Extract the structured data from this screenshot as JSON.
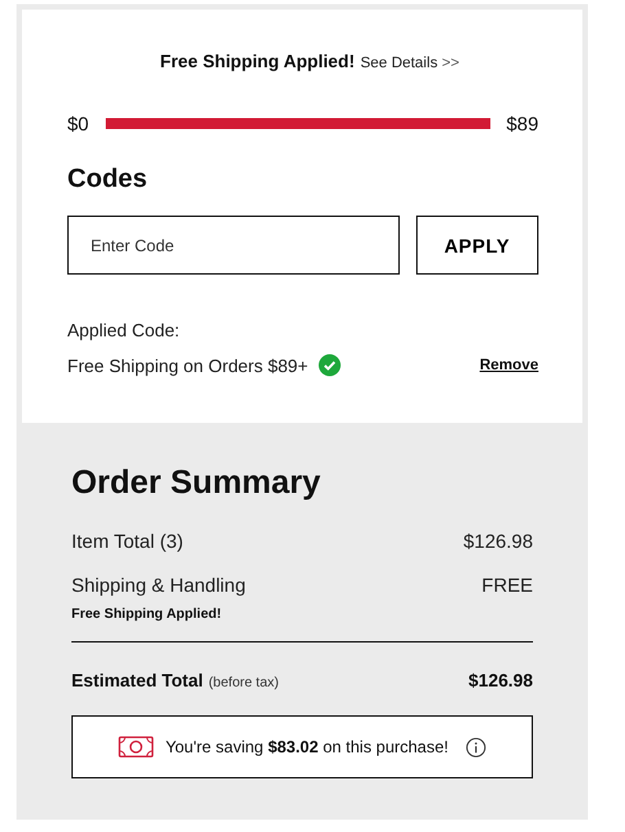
{
  "shipping_banner": {
    "title": "Free Shipping Applied!",
    "link": "See Details",
    "link_arrows": ">>"
  },
  "progress": {
    "min_label": "$0",
    "max_label": "$89",
    "level": 1
  },
  "codes": {
    "title": "Codes",
    "placeholder": "Enter Code",
    "apply_button": "APPLY",
    "applied_label": "Applied Code:",
    "applied_code": "Free Shipping on Orders $89+",
    "applied_valid": true,
    "remove_link": "Remove"
  },
  "order_summary": {
    "title": "Order Summary",
    "lines": [
      {
        "label": "Item Total (3)",
        "value": "$126.98"
      },
      {
        "label": "Shipping & Handling",
        "value": "FREE",
        "note": "Free Shipping Applied!"
      }
    ],
    "total": {
      "label": "Estimated Total",
      "qualifier": "(before tax)",
      "value": "$126.98"
    },
    "savings": "You're saving **$83.02** on this purchase!"
  }
}
